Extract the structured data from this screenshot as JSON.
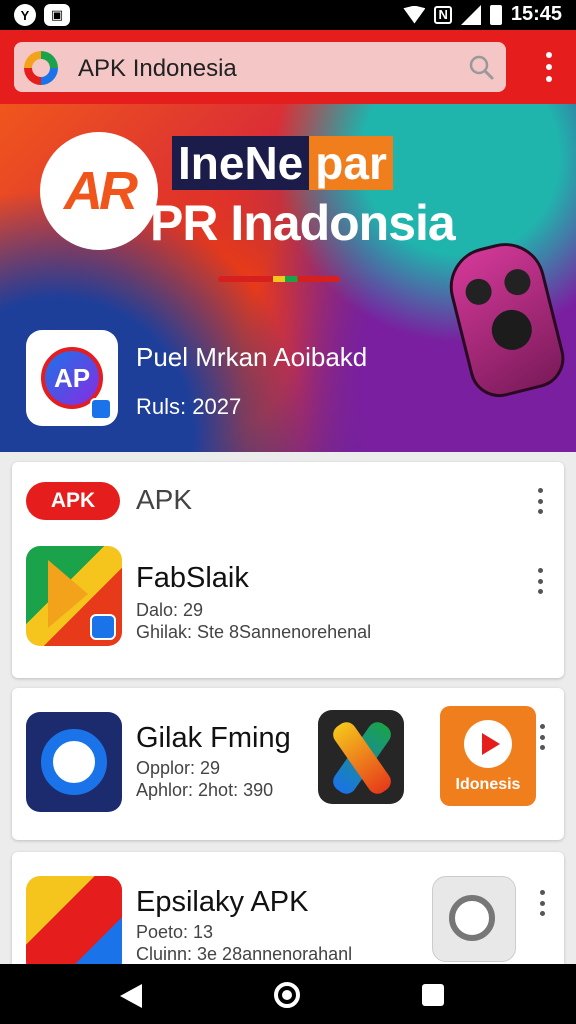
{
  "status_bar": {
    "time": "15:45",
    "left_icons": [
      "notification-icon",
      "media-icon"
    ],
    "right_icons": [
      "wifi-icon",
      "nfc-icon",
      "signal-icon",
      "battery-icon"
    ]
  },
  "app_bar": {
    "title": "APK Indonesia",
    "color": "#e61d1d"
  },
  "banner": {
    "logo_text": "AR",
    "title_line1_a": "IneNe",
    "title_line1_b": "par",
    "title_line2": "PR Inadonsia",
    "featured_app": {
      "icon_text": "AP",
      "name": "Puel Mrkan Aoibakd",
      "subtitle": "Ruls: 2027"
    }
  },
  "section": {
    "pill": "APK",
    "title": "APK"
  },
  "apps": [
    {
      "name": "FabSlaik",
      "line1": "Dalo: 29",
      "line2": "Ghilak: Ste 8Sannenorehenal"
    },
    {
      "name": "Gilak Fming",
      "line1": "Opplor: 29",
      "line2": "Aphlor: 2hot: 390",
      "extra_icon_label": "Idonesis"
    },
    {
      "name": "Epsilaky APK",
      "line1": "Poeto: 13",
      "line2": "Cluinn: 3e 28annenorahanl"
    }
  ],
  "nav": [
    "back",
    "home",
    "recent"
  ]
}
